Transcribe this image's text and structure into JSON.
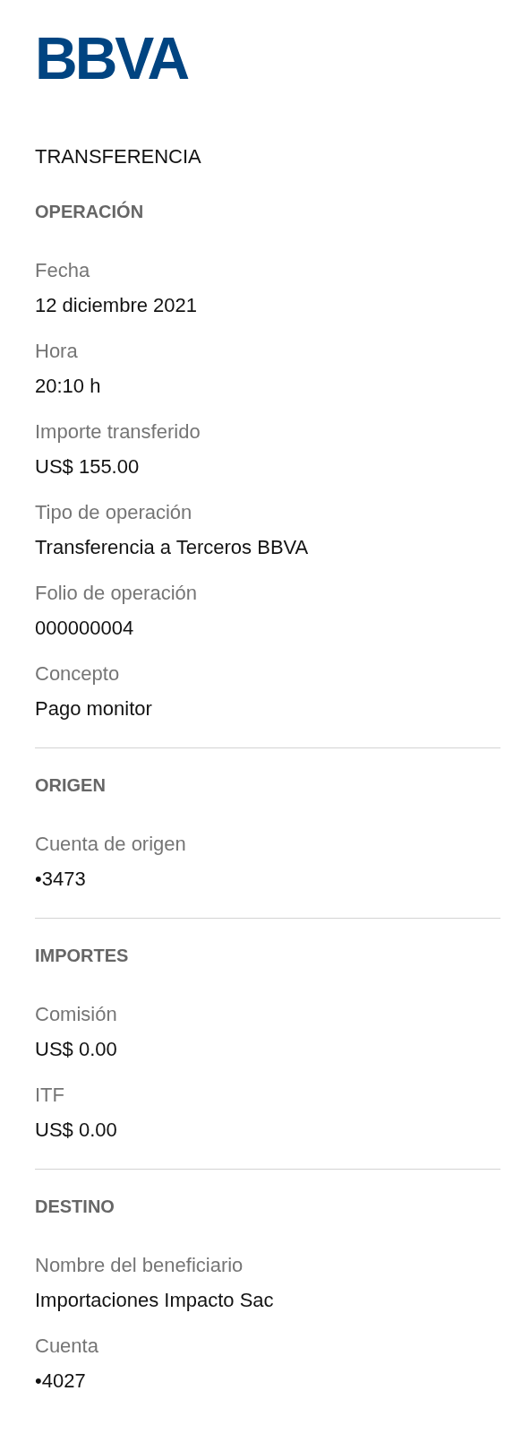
{
  "logo": "BBVA",
  "title": "TRANSFERENCIA",
  "sections": [
    {
      "title": "OPERACIÓN",
      "fields": [
        {
          "label": "Fecha",
          "value": "12 diciembre 2021"
        },
        {
          "label": "Hora",
          "value": "20:10 h"
        },
        {
          "label": "Importe transferido",
          "value": "US$ 155.00"
        },
        {
          "label": "Tipo de operación",
          "value": "Transferencia a Terceros BBVA"
        },
        {
          "label": "Folio de operación",
          "value": "000000004"
        },
        {
          "label": "Concepto",
          "value": "Pago monitor"
        }
      ]
    },
    {
      "title": "ORIGEN",
      "fields": [
        {
          "label": "Cuenta de origen",
          "value": "•3473"
        }
      ]
    },
    {
      "title": "IMPORTES",
      "fields": [
        {
          "label": "Comisión",
          "value": "US$ 0.00"
        },
        {
          "label": "ITF",
          "value": "US$ 0.00"
        }
      ]
    },
    {
      "title": "DESTINO",
      "fields": [
        {
          "label": "Nombre del beneficiario",
          "value": "Importaciones Impacto Sac"
        },
        {
          "label": "Cuenta",
          "value": "•4027"
        }
      ]
    }
  ]
}
